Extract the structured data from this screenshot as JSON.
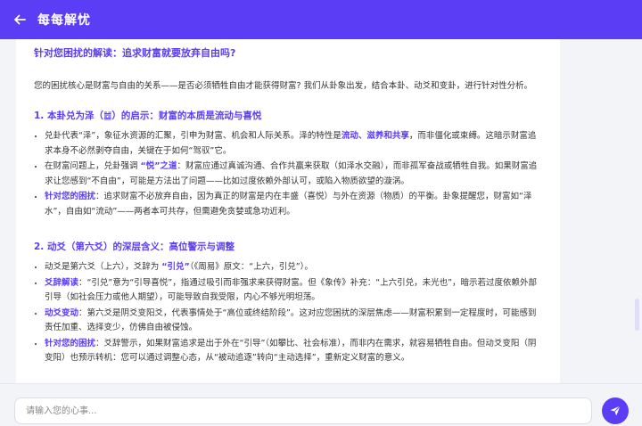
{
  "header": {
    "title": "每每解忧",
    "back_icon": "arrow-left-icon"
  },
  "content": {
    "question": "针对您困扰的解读：追求财富就要放弃自由吗?",
    "intro": "您的困扰核心是财富与自由的关系——是否必须牺牲自由才能获得财富? 我们从卦象出发，结合本卦、动爻和变卦，进行针对性分析。",
    "section1": {
      "title": "1. 本卦兑为泽（䷹）的启示：财富的本质是流动与喜悦",
      "b1_text1": "兑卦代表“泽”，象征水资源的汇聚，引申为财富、机会和人际关系。泽的特性是",
      "b1_hl": "流动、滋养和共享",
      "b1_text2": "，而非僵化或束缚。这暗示财富追求本身不必然剥夺自由，关键在于如何“驾驭”它。",
      "b2_text1": "在财富问题上，兑卦强调 ",
      "b2_hl": "“悦”之道",
      "b2_text2": "：财富应通过真诚沟通、合作共赢来获取（如泽水交融），而非孤军奋战或牺牲自我。如果财富追求让您感到“不自由”，可能是方法出了问题——比如过度依赖外部认可，或陷入物质欲望的漩涡。",
      "b3_hl": "针对您的困扰",
      "b3_text": "：追求财富不必放弃自由，因为真正的财富是内在丰盛（喜悦）与外在资源（物质）的平衡。卦象提醒您，财富如“泽水”，自由如“流动”——两者本可共存，但需避免贪婪或急功近利。"
    },
    "section2": {
      "title": "2. 动爻（第六爻）的深层含义：高位警示与调整",
      "b1_text1": "动爻是第六爻（上六），爻辞为 ",
      "b1_hl": "“引兑”",
      "b1_text2": "（《周易》原文：“上六，引兑”）。",
      "b2_hl": "爻辞解读",
      "b2_text": "：“引兑”意为“引导喜悦”，指通过吸引而非强求来获得财富。但《象传》补充：“上六引兑，未光也”，暗示若过度依赖外部引导（如社会压力或他人期望），可能导致自我受限，内心不够光明坦荡。",
      "b3_hl": "动爻变动",
      "b3_text": "：第六爻是阴爻变阳爻，代表事情处于“高位或终结阶段”。这对应您困扰的深层焦虑——财富积累到一定程度时，可能感到责任加重、选择变少，仿佛自由被侵蚀。",
      "b4_hl": "针对您的困扰",
      "b4_text": "：爻辞警示，如果财富追求是出于外在“引导”（如攀比、社会标准），而非内在需求，就容易牺牲自由。但动爻变阳（阴变阳）也预示转机：您可以通过调整心态，从“被动追逐”转向“主动选择”，重新定义财富的意义。"
    }
  },
  "footer": {
    "placeholder": "请输入您的心事...",
    "send_icon": "paper-plane-icon"
  },
  "colors": {
    "accent": "#5b3df5",
    "background": "#f3f4f8"
  }
}
